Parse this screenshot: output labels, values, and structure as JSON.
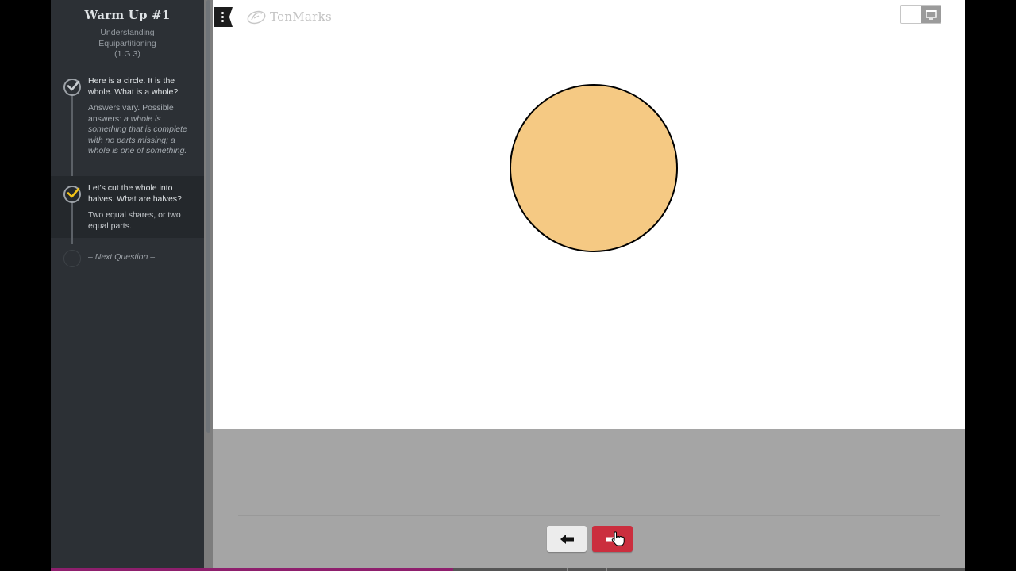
{
  "lesson": {
    "title": "Warm Up #1",
    "subtitle": "Understanding Equipartitioning",
    "standard": "(1.G.3)"
  },
  "steps": [
    {
      "question": "Here is a circle. It is the whole. What is a whole?",
      "answer_prefix": "Answers vary. Possible answers: ",
      "answer_italic": "a whole is something that is complete with no parts missing; a whole is one of something.",
      "completed": true,
      "check_color": "#c8ccd0"
    },
    {
      "question": "Let's cut the whole into halves. What are halves?",
      "answer": "Two equal shares, or two equal parts.",
      "completed": true,
      "active": true,
      "check_color": "#f2c318"
    }
  ],
  "next_question_label": "– Next Question –",
  "brand": {
    "name": "TenMarks",
    "logo_icon": "tenmarks-logo-icon"
  },
  "toolbar": {
    "menu_icon": "vertical-dots-icon",
    "view_toggle_icon": "presentation-screen-icon"
  },
  "canvas": {
    "shape": "circle",
    "fill": "#f5c983",
    "stroke": "#000000"
  },
  "navigation": {
    "back_icon": "arrow-left-icon",
    "forward_icon": "arrow-right-icon",
    "forward_color": "#cb2e3e",
    "cursor_icon": "hand-pointer-icon"
  },
  "progress": {
    "fraction": 0.44,
    "fill_color": "#8e1f6d"
  }
}
